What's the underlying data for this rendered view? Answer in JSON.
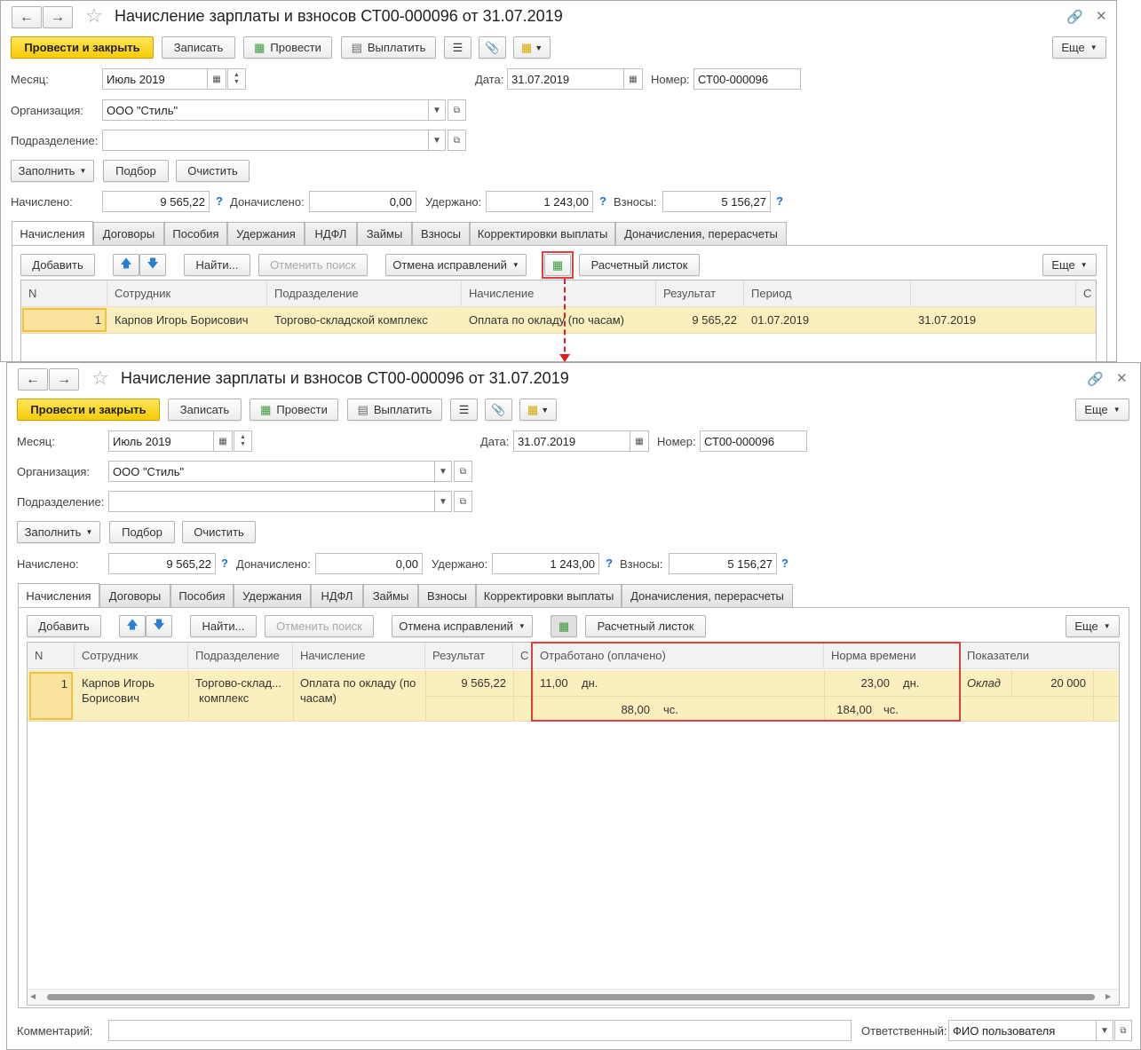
{
  "window": {
    "title": "Начисление зарплаты и взносов СТ00-000096 от 31.07.2019"
  },
  "toolbar": {
    "post_close": "Провести и закрыть",
    "save": "Записать",
    "post": "Провести",
    "pay": "Выплатить",
    "more": "Еще"
  },
  "header": {
    "month_label": "Месяц:",
    "month_value": "Июль 2019",
    "date_label": "Дата:",
    "date_value": "31.07.2019",
    "number_label": "Номер:",
    "number_value": "СТ00-000096",
    "org_label": "Организация:",
    "org_value": "ООО \"Стиль\"",
    "dept_label": "Подразделение:",
    "dept_value": ""
  },
  "actions": {
    "fill": "Заполнить",
    "select": "Подбор",
    "clear": "Очистить"
  },
  "totals": {
    "accrued_label": "Начислено:",
    "accrued_value": "9 565,22",
    "additional_label": "Доначислено:",
    "additional_value": "0,00",
    "withheld_label": "Удержано:",
    "withheld_value": "1 243,00",
    "contrib_label": "Взносы:",
    "contrib_value": "5 156,27",
    "help": "?"
  },
  "tabs": [
    "Начисления",
    "Договоры",
    "Пособия",
    "Удержания",
    "НДФЛ",
    "Займы",
    "Взносы",
    "Корректировки выплаты",
    "Доначисления, перерасчеты"
  ],
  "table_toolbar": {
    "add": "Добавить",
    "find": "Найти...",
    "cancel_search": "Отменить поиск",
    "cancel_fix": "Отмена исправлений",
    "payslip": "Расчетный листок",
    "more": "Еще"
  },
  "grid_top": {
    "headers": [
      "N",
      "Сотрудник",
      "Подразделение",
      "Начисление",
      "Результат",
      "Период",
      "",
      "С"
    ],
    "row": [
      "1",
      "Карпов Игорь Борисович",
      "Торгово-складской комплекс",
      "Оплата по окладу (по часам)",
      "9 565,22",
      "01.07.2019",
      "31.07.2019"
    ]
  },
  "grid_bottom": {
    "headers": [
      "N",
      "Сотрудник",
      "Подразделение",
      "Начисление",
      "Результат",
      "С",
      "Отработано (оплачено)",
      "Норма времени",
      "Показатели"
    ],
    "row": {
      "n": "1",
      "employee_1": "Карпов Игорь",
      "employee_2": "Борисович",
      "dept_1": "Торгово-склад...",
      "dept_2": "комплекс",
      "accrual_1": "Оплата по окладу (по",
      "accrual_2": "часам)",
      "result": "9 565,22",
      "worked_days": "11,00",
      "days_unit": "дн.",
      "worked_hours": "88,00",
      "hours_unit": "чс.",
      "norm_days": "23,00",
      "norm_days_unit": "дн.",
      "norm_hours": "184,00",
      "norm_hours_unit": "чс.",
      "indicator_name": "Оклад",
      "indicator_value": "20 000"
    }
  },
  "footer": {
    "comment_label": "Комментарий:",
    "comment_value": "",
    "responsible_label": "Ответственный:",
    "responsible_value": "ФИО пользователя"
  },
  "colors": {
    "primary_button": "#f6cc05",
    "row_highlight": "#fbefbf",
    "selection_frame": "#e04040",
    "help_mark": "#1a73c8"
  }
}
